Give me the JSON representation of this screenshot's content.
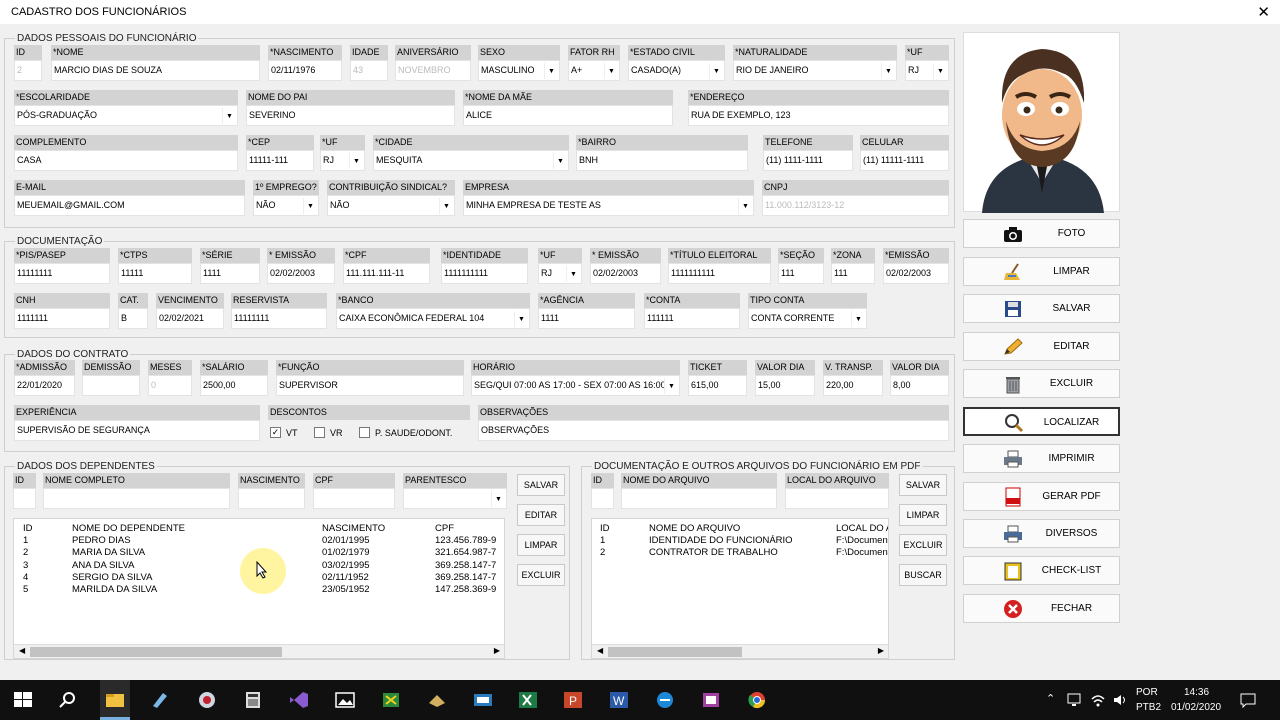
{
  "window": {
    "title": "CADASTRO DOS FUNCIONÁRIOS",
    "close": "✕"
  },
  "personal": {
    "legend": "DADOS PESSOAIS DO FUNCIONÁRIO",
    "id": {
      "label": "ID",
      "value": "2"
    },
    "nome": {
      "label": "*NOME",
      "value": "MARCIO DIAS DE SOUZA"
    },
    "nascimento": {
      "label": "*NASCIMENTO",
      "value": "02/11/1976"
    },
    "idade": {
      "label": "IDADE",
      "value": "43"
    },
    "aniversario": {
      "label": "ANIVERSÁRIO",
      "value": "NOVEMBRO"
    },
    "sexo": {
      "label": "SEXO",
      "value": "MASCULINO"
    },
    "fator_rh": {
      "label": "FATOR RH",
      "value": "A+"
    },
    "estado_civil": {
      "label": "*ESTADO CIVIL",
      "value": "CASADO(A)"
    },
    "naturalidade": {
      "label": "*NATURALIDADE",
      "value": "RIO DE JANEIRO"
    },
    "uf": {
      "label": "*UF",
      "value": "RJ"
    },
    "escolaridade": {
      "label": "*ESCOLARIDADE",
      "value": "PÓS-GRADUAÇÃO"
    },
    "nome_pai": {
      "label": "NOME DO PAI",
      "value": "SEVERINO"
    },
    "nome_mae": {
      "label": "*NOME DA MÃE",
      "value": "ALICE"
    },
    "endereco": {
      "label": "*ENDEREÇO",
      "value": "RUA DE EXEMPLO, 123"
    },
    "complemento": {
      "label": "COMPLEMENTO",
      "value": "CASA"
    },
    "cep": {
      "label": "*CEP",
      "value": "11111-111"
    },
    "uf2": {
      "label": "*UF",
      "value": "RJ"
    },
    "cidade": {
      "label": "*CIDADE",
      "value": "MESQUITA"
    },
    "bairro": {
      "label": "*BAIRRO",
      "value": "BNH"
    },
    "telefone": {
      "label": "TELEFONE",
      "value": "(11) 1111-1111"
    },
    "celular": {
      "label": "CELULAR",
      "value": "(11) 11111-1111"
    },
    "email": {
      "label": "E-MAIL",
      "value": "MEUEMAIL@GMAIL.COM"
    },
    "primeiro_emprego": {
      "label": "1º EMPREGO?",
      "value": "NÃO"
    },
    "contribuicao": {
      "label": "CONTRIBUIÇÃO SINDICAL?",
      "value": "NÃO"
    },
    "empresa": {
      "label": "EMPRESA",
      "value": "MINHA EMPRESA DE TESTE AS"
    },
    "cnpj": {
      "label": "CNPJ",
      "value": "11.000.112/3123-12"
    }
  },
  "docs": {
    "legend": "DOCUMENTAÇÃO",
    "pis": {
      "label": "*PIS/PASEP",
      "value": "11111111"
    },
    "ctps": {
      "label": "*CTPS",
      "value": "11111"
    },
    "serie": {
      "label": "*SÉRIE",
      "value": "1111"
    },
    "emissao1": {
      "label": "* EMISSÃO",
      "value": "02/02/2003"
    },
    "cpf": {
      "label": "*CPF",
      "value": "111.111.111-11"
    },
    "identidade": {
      "label": "*IDENTIDADE",
      "value": "1111111111"
    },
    "uf": {
      "label": "*UF",
      "value": "RJ"
    },
    "emissao2": {
      "label": "* EMISSÃO",
      "value": "02/02/2003"
    },
    "titulo": {
      "label": "*TÍTULO ELEITORAL",
      "value": "1111111111"
    },
    "secao": {
      "label": "*SEÇÃO",
      "value": "111"
    },
    "zona": {
      "label": "*ZONA",
      "value": "111"
    },
    "emissao3": {
      "label": "*EMISSÃO",
      "value": "02/02/2003"
    },
    "cnh": {
      "label": "CNH",
      "value": "1111111"
    },
    "cat": {
      "label": "CAT.",
      "value": "B"
    },
    "vencimento": {
      "label": "VENCIMENTO",
      "value": "02/02/2021"
    },
    "reservista": {
      "label": "RESERVISTA",
      "value": "11111111"
    },
    "banco": {
      "label": "*BANCO",
      "value": "CAIXA ECONÔMICA FEDERAL 104"
    },
    "agencia": {
      "label": "*AGÊNCIA",
      "value": "1111"
    },
    "conta": {
      "label": "*CONTA",
      "value": "111111"
    },
    "tipo_conta": {
      "label": "TIPO CONTA",
      "value": "CONTA CORRENTE"
    }
  },
  "contract": {
    "legend": "DADOS DO CONTRATO",
    "admissao": {
      "label": "*ADMISSÃO",
      "value": "22/01/2020"
    },
    "demissao": {
      "label": "DEMISSÃO",
      "value": ""
    },
    "meses": {
      "label": "MESES",
      "value": "0"
    },
    "salario": {
      "label": "*SALÁRIO",
      "value": "2500,00"
    },
    "funcao": {
      "label": "*FUNÇÃO",
      "value": "SUPERVISOR"
    },
    "horario": {
      "label": "HORÁRIO",
      "value": "SEG/QUI 07:00 AS 17:00 - SEX 07:00 AS 16:00"
    },
    "ticket": {
      "label": "TICKET",
      "value": "615,00"
    },
    "valor_dia1": {
      "label": "VALOR DIA",
      "value": "15,00"
    },
    "transp": {
      "label": "V. TRANSP.",
      "value": "220,00"
    },
    "valor_dia2": {
      "label": "VALOR DIA",
      "value": "8,00"
    },
    "experiencia": {
      "label": "EXPERIÊNCIA",
      "value": "SUPERVISÃO DE SEGURANÇA"
    },
    "descontos": {
      "label": "DESCONTOS",
      "vt": "VT",
      "vr": "VR",
      "saude": "P. SAUDE/ODONT.",
      "vt_checked": "✓"
    },
    "observacoes": {
      "label": "OBSERVAÇÕES",
      "value": "OBSERVAÇÕES"
    }
  },
  "dependents": {
    "legend": "DADOS DOS DEPENDENTES",
    "form": {
      "id": "ID",
      "nome": "NOME COMPLETO",
      "nasc": "NASCIMENTO",
      "cpf": "CPF",
      "parentesco": "PARENTESCO"
    },
    "columns": [
      "ID",
      "NOME DO DEPENDENTE",
      "NASCIMENTO",
      "CPF"
    ],
    "rows": [
      [
        "1",
        "PEDRO DIAS",
        "02/01/1995",
        "123.456.789-9"
      ],
      [
        "2",
        "MARIA DA SILVA",
        "01/02/1979",
        "321.654.987-7"
      ],
      [
        "3",
        "ANA DA SILVA",
        "03/02/1995",
        "369.258.147-7"
      ],
      [
        "4",
        "SERGIO DA SILVA",
        "02/11/1952",
        "369.258.147-7"
      ],
      [
        "5",
        "MARILDA DA SILVA",
        "23/05/1952",
        "147.258.369-9"
      ]
    ],
    "buttons": [
      "SALVAR",
      "EDITAR",
      "LIMPAR",
      "EXCLUIR"
    ]
  },
  "files": {
    "legend": "DOCUMENTAÇÃO E OUTROS ARQUIVOS  DO FUNCIONÁRIO EM PDF",
    "form": {
      "id": "ID",
      "nome": "NOME DO ARQUIVO",
      "local": "LOCAL DO ARQUIVO"
    },
    "columns": [
      "ID",
      "NOME DO ARQUIVO",
      "LOCAL DO A"
    ],
    "rows": [
      [
        "1",
        "IDENTIDADE DO FUNCIONÁRIO",
        "F:\\Documen"
      ],
      [
        "2",
        "CONTRATOR DE TRABALHO",
        "F:\\Documen"
      ]
    ],
    "buttons": [
      "SALVAR",
      "LIMPAR",
      "EXCLUIR",
      "BUSCAR"
    ]
  },
  "actions": [
    "FOTO",
    "LIMPAR",
    "SALVAR",
    "EDITAR",
    "EXCLUIR",
    "LOCALIZAR",
    "IMPRIMIR",
    "GERAR PDF",
    "DIVERSOS",
    "CHECK-LIST",
    "FECHAR"
  ],
  "taskbar": {
    "lang1": "POR",
    "lang2": "PTB2",
    "time": "14:36",
    "date": "01/02/2020"
  }
}
